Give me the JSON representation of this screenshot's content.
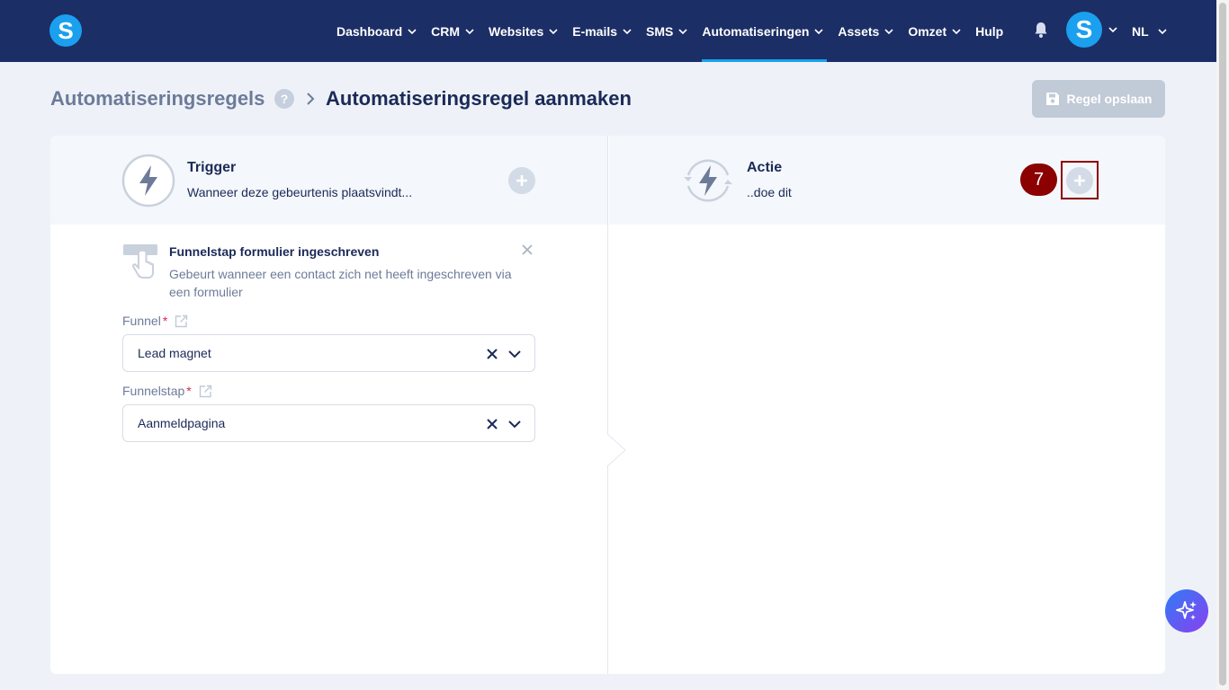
{
  "nav": {
    "logo_letter": "S",
    "items": [
      {
        "label": "Dashboard",
        "has_dropdown": true
      },
      {
        "label": "CRM",
        "has_dropdown": true
      },
      {
        "label": "Websites",
        "has_dropdown": true
      },
      {
        "label": "E-mails",
        "has_dropdown": true
      },
      {
        "label": "SMS",
        "has_dropdown": true
      },
      {
        "label": "Automatiseringen",
        "has_dropdown": true,
        "active": true
      },
      {
        "label": "Assets",
        "has_dropdown": true
      },
      {
        "label": "Omzet",
        "has_dropdown": true
      },
      {
        "label": "Hulp",
        "has_dropdown": false
      }
    ],
    "bell_icon": "bell-icon",
    "avatar_letter": "S",
    "language": "NL"
  },
  "breadcrumb": {
    "root": "Automatiseringsregels",
    "help": "?",
    "current": "Automatiseringsregel aanmaken"
  },
  "save_button": {
    "label": "Regel opslaan",
    "icon": "save-icon",
    "disabled": true
  },
  "trigger": {
    "title": "Trigger",
    "subtitle": "Wanneer deze gebeurtenis plaatsvindt...",
    "item": {
      "title": "Funnelstap formulier ingeschreven",
      "description": "Gebeurt wanneer een contact zich net heeft ingeschreven via een formulier"
    },
    "fields": [
      {
        "label": "Funnel",
        "required_mark": "*",
        "value": "Lead magnet"
      },
      {
        "label": "Funnelstap",
        "required_mark": "*",
        "value": "Aanmeldpagina"
      }
    ]
  },
  "action": {
    "title": "Actie",
    "subtitle": "..doe dit",
    "annotation_badge": "7"
  },
  "colors": {
    "nav_bg": "#1c2e66",
    "accent": "#1aa0ef",
    "text_dark": "#1b2a57",
    "text_muted": "#6d7b99",
    "badge": "#8b0000"
  }
}
